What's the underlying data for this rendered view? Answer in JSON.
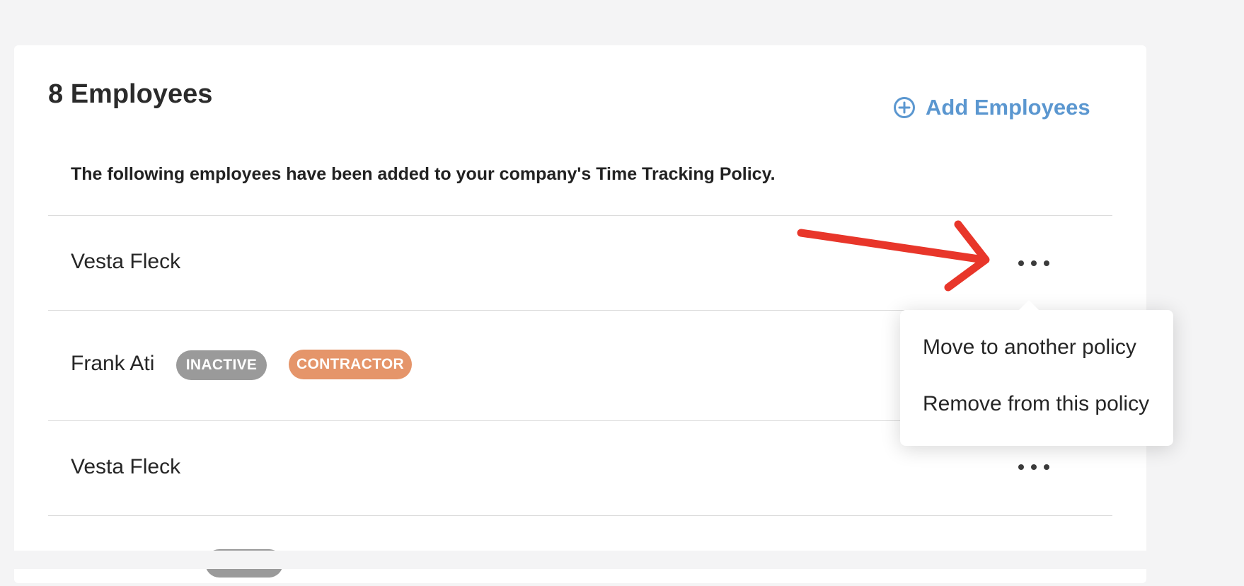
{
  "header": {
    "title": "8 Employees",
    "add_label": "Add Employees",
    "description": "The following employees have been added to your company's Time Tracking Policy."
  },
  "rows": [
    {
      "name": "Vesta Fleck",
      "badges": []
    },
    {
      "name": "Frank Ati",
      "badges": [
        "INACTIVE",
        "CONTRACTOR"
      ]
    },
    {
      "name": "Vesta Fleck",
      "badges": []
    }
  ],
  "menu": {
    "items": [
      "Move to another policy",
      "Remove from this policy"
    ]
  },
  "colors": {
    "accent": "#5b97d0",
    "inactive_badge": "#9a9a9a",
    "contractor_badge": "#e5956a",
    "annotation_arrow": "#e8362a"
  },
  "icons": {
    "add": "plus-circle-icon",
    "more": "more-horizontal-icon"
  }
}
